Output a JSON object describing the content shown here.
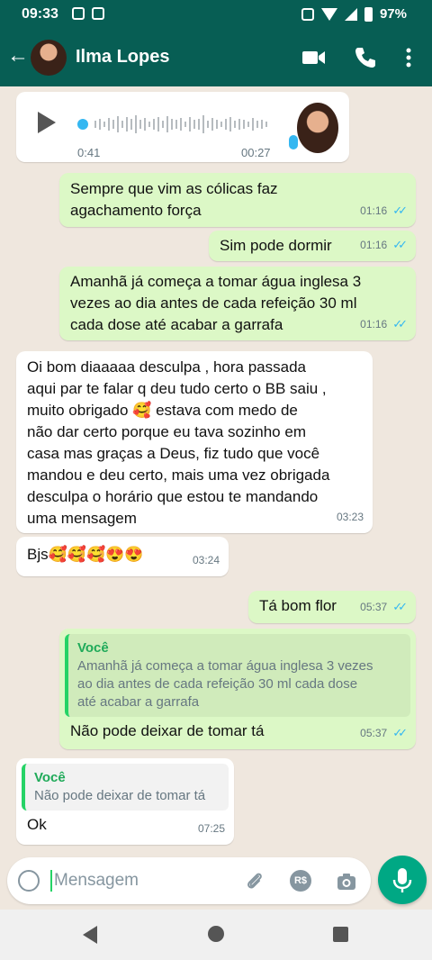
{
  "status_bar": {
    "time": "09:33",
    "battery": "97%"
  },
  "header": {
    "back": "←",
    "contact_name": "Ilma Lopes"
  },
  "voice_note": {
    "position": "0:41",
    "duration": "00:27"
  },
  "messages": [
    {
      "text": "Sempre que vim as cólicas faz\nagachamento força",
      "time": "01:16"
    },
    {
      "text": "Sim pode dormir",
      "time": "01:16"
    },
    {
      "text": "Amanhã já começa a tomar água inglesa 3\nvezes ao dia antes de cada refeição 30 ml\ncada dose até acabar a garrafa",
      "time": "01:16"
    },
    {
      "text": "Oi bom diaaaaa desculpa , hora passada\naqui par te falar q deu tudo certo o BB saiu ,\nmuito obrigado 🥰 estava com medo de\nnão dar certo porque eu tava sozinho em\ncasa mas graças a Deus, fiz tudo que você\nmandou e deu certo, mais uma vez obrigada\ndesculpa o horário que estou te mandando\numa mensagem",
      "time": "03:23"
    },
    {
      "text": "Bjs🥰🥰🥰😍😍",
      "time": "03:24"
    },
    {
      "text": "Tá bom flor",
      "time": "05:37"
    },
    {
      "quote_name": "Você",
      "quote_text": "Amanhã já começa a tomar água inglesa 3 vezes\nao dia antes de cada refeição 30 ml cada dose\naté acabar a garrafa",
      "text": "Não pode deixar de tomar tá",
      "time": "05:37"
    },
    {
      "quote_name": "Você",
      "quote_text": "Não pode deixar de tomar tá",
      "text": "Ok",
      "time": "07:25"
    }
  ],
  "composer": {
    "placeholder": "Mensagem",
    "pay_label": "R$"
  },
  "colors": {
    "header": "#075e54",
    "outgoing": "#dcf8c6",
    "incoming": "#ffffff",
    "accent": "#00a884",
    "read_ticks": "#34b7f1"
  },
  "icons": [
    "back-arrow-icon",
    "video-call-icon",
    "phone-icon",
    "more-options-icon",
    "play-icon",
    "microphone-icon",
    "emoji-icon",
    "attach-icon",
    "camera-icon",
    "nav-back-icon",
    "nav-home-icon",
    "nav-recents-icon"
  ]
}
